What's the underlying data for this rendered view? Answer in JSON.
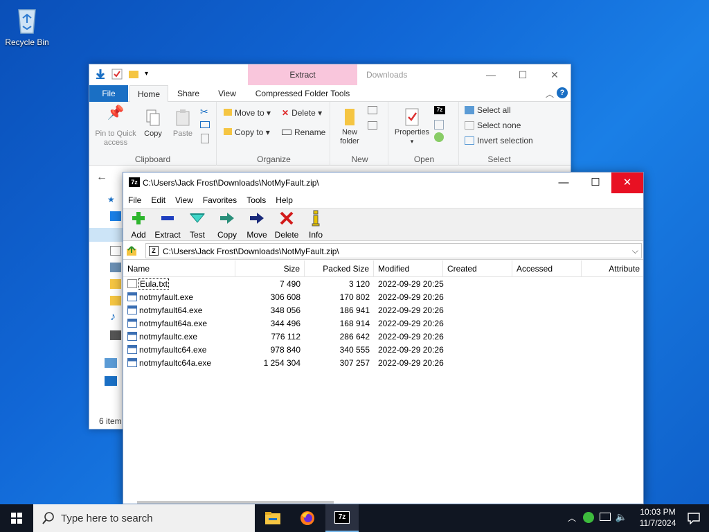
{
  "desktop": {
    "recycle_bin": "Recycle Bin"
  },
  "explorer": {
    "title": "Downloads",
    "contextual_tab": "Extract",
    "tabs": {
      "file": "File",
      "home": "Home",
      "share": "Share",
      "view": "View",
      "cft": "Compressed Folder Tools"
    },
    "clipboard": {
      "pin": "Pin to Quick access",
      "copy": "Copy",
      "paste": "Paste",
      "label": "Clipboard"
    },
    "organize": {
      "move_to": "Move to",
      "copy_to": "Copy to",
      "delete": "Delete",
      "rename": "Rename",
      "label": "Organize"
    },
    "new": {
      "new_folder": "New folder",
      "label": "New"
    },
    "open": {
      "properties": "Properties",
      "label": "Open"
    },
    "select": {
      "select_all": "Select all",
      "select_none": "Select none",
      "invert": "Invert selection",
      "label": "Select"
    },
    "status": "6 item"
  },
  "zip": {
    "title": "C:\\Users\\Jack Frost\\Downloads\\NotMyFault.zip\\",
    "menu": [
      "File",
      "Edit",
      "View",
      "Favorites",
      "Tools",
      "Help"
    ],
    "toolbar": {
      "add": "Add",
      "extract": "Extract",
      "test": "Test",
      "copy": "Copy",
      "move": "Move",
      "delete": "Delete",
      "info": "Info"
    },
    "address": "C:\\Users\\Jack Frost\\Downloads\\NotMyFault.zip\\",
    "columns": {
      "name": "Name",
      "size": "Size",
      "packed": "Packed Size",
      "modified": "Modified",
      "created": "Created",
      "accessed": "Accessed",
      "attributes": "Attribute"
    },
    "files": [
      {
        "name": "Eula.txt",
        "size": "7 490",
        "packed": "3 120",
        "modified": "2022-09-29 20:25",
        "type": "txt"
      },
      {
        "name": "notmyfault.exe",
        "size": "306 608",
        "packed": "170 802",
        "modified": "2022-09-29 20:26",
        "type": "exe"
      },
      {
        "name": "notmyfault64.exe",
        "size": "348 056",
        "packed": "186 941",
        "modified": "2022-09-29 20:26",
        "type": "exe"
      },
      {
        "name": "notmyfault64a.exe",
        "size": "344 496",
        "packed": "168 914",
        "modified": "2022-09-29 20:26",
        "type": "exe"
      },
      {
        "name": "notmyfaultc.exe",
        "size": "776 112",
        "packed": "286 642",
        "modified": "2022-09-29 20:26",
        "type": "exe"
      },
      {
        "name": "notmyfaultc64.exe",
        "size": "978 840",
        "packed": "340 555",
        "modified": "2022-09-29 20:26",
        "type": "exe"
      },
      {
        "name": "notmyfaultc64a.exe",
        "size": "1 254 304",
        "packed": "307 257",
        "modified": "2022-09-29 20:26",
        "type": "exe"
      }
    ]
  },
  "taskbar": {
    "search_placeholder": "Type here to search",
    "time": "10:03 PM",
    "date": "11/7/2024"
  }
}
